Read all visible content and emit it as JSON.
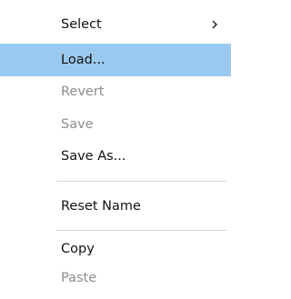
{
  "context_menu": {
    "items": [
      {
        "label": "Select",
        "enabled": true,
        "has_submenu": true,
        "highlighted": false
      },
      {
        "label": "Load...",
        "enabled": true,
        "has_submenu": false,
        "highlighted": true
      },
      {
        "label": "Revert",
        "enabled": false,
        "has_submenu": false,
        "highlighted": false
      },
      {
        "label": "Save",
        "enabled": false,
        "has_submenu": false,
        "highlighted": false
      },
      {
        "label": "Save As...",
        "enabled": true,
        "has_submenu": false,
        "highlighted": false
      },
      {
        "label": "Reset Name",
        "enabled": true,
        "has_submenu": false,
        "highlighted": false
      },
      {
        "label": "Copy",
        "enabled": true,
        "has_submenu": false,
        "highlighted": false
      },
      {
        "label": "Paste",
        "enabled": false,
        "has_submenu": false,
        "highlighted": false
      }
    ],
    "submenu_icon": "chevron-right-icon",
    "colors": {
      "highlight": "#99c9ef",
      "enabled_text": "#111111",
      "disabled_text": "#8c8c8c",
      "separator": "#d7d7d7"
    }
  }
}
